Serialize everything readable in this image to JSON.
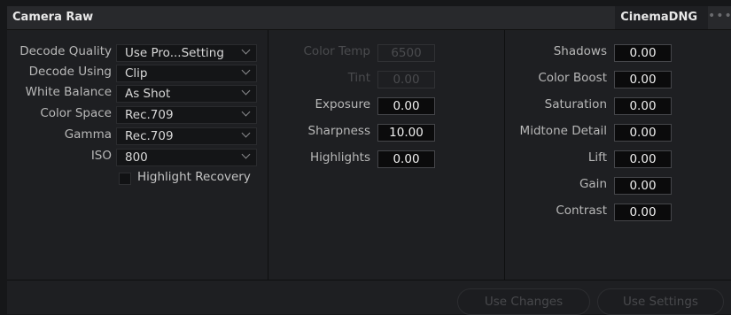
{
  "header": {
    "title": "Camera Raw",
    "tab_label": "CinemaDNG",
    "more_glyph": "•••"
  },
  "left": {
    "decode_quality": {
      "label": "Decode Quality",
      "value": "Use Pro...Setting"
    },
    "decode_using": {
      "label": "Decode Using",
      "value": "Clip"
    },
    "white_balance": {
      "label": "White Balance",
      "value": "As Shot"
    },
    "color_space": {
      "label": "Color Space",
      "value": "Rec.709"
    },
    "gamma": {
      "label": "Gamma",
      "value": "Rec.709"
    },
    "iso": {
      "label": "ISO",
      "value": "800"
    },
    "highlight_recovery": {
      "label": "Highlight Recovery",
      "checked": false
    }
  },
  "middle": {
    "color_temp": {
      "label": "Color Temp",
      "value": "6500",
      "enabled": false
    },
    "tint": {
      "label": "Tint",
      "value": "0.00",
      "enabled": false
    },
    "exposure": {
      "label": "Exposure",
      "value": "0.00"
    },
    "sharpness": {
      "label": "Sharpness",
      "value": "10.00"
    },
    "highlights": {
      "label": "Highlights",
      "value": "0.00"
    }
  },
  "right": {
    "shadows": {
      "label": "Shadows",
      "value": "0.00"
    },
    "color_boost": {
      "label": "Color Boost",
      "value": "0.00"
    },
    "saturation": {
      "label": "Saturation",
      "value": "0.00"
    },
    "midtone_detail": {
      "label": "Midtone Detail",
      "value": "0.00"
    },
    "lift": {
      "label": "Lift",
      "value": "0.00"
    },
    "gain": {
      "label": "Gain",
      "value": "0.00"
    },
    "contrast": {
      "label": "Contrast",
      "value": "0.00"
    }
  },
  "footer": {
    "use_changes": "Use Changes",
    "use_settings": "Use Settings"
  }
}
